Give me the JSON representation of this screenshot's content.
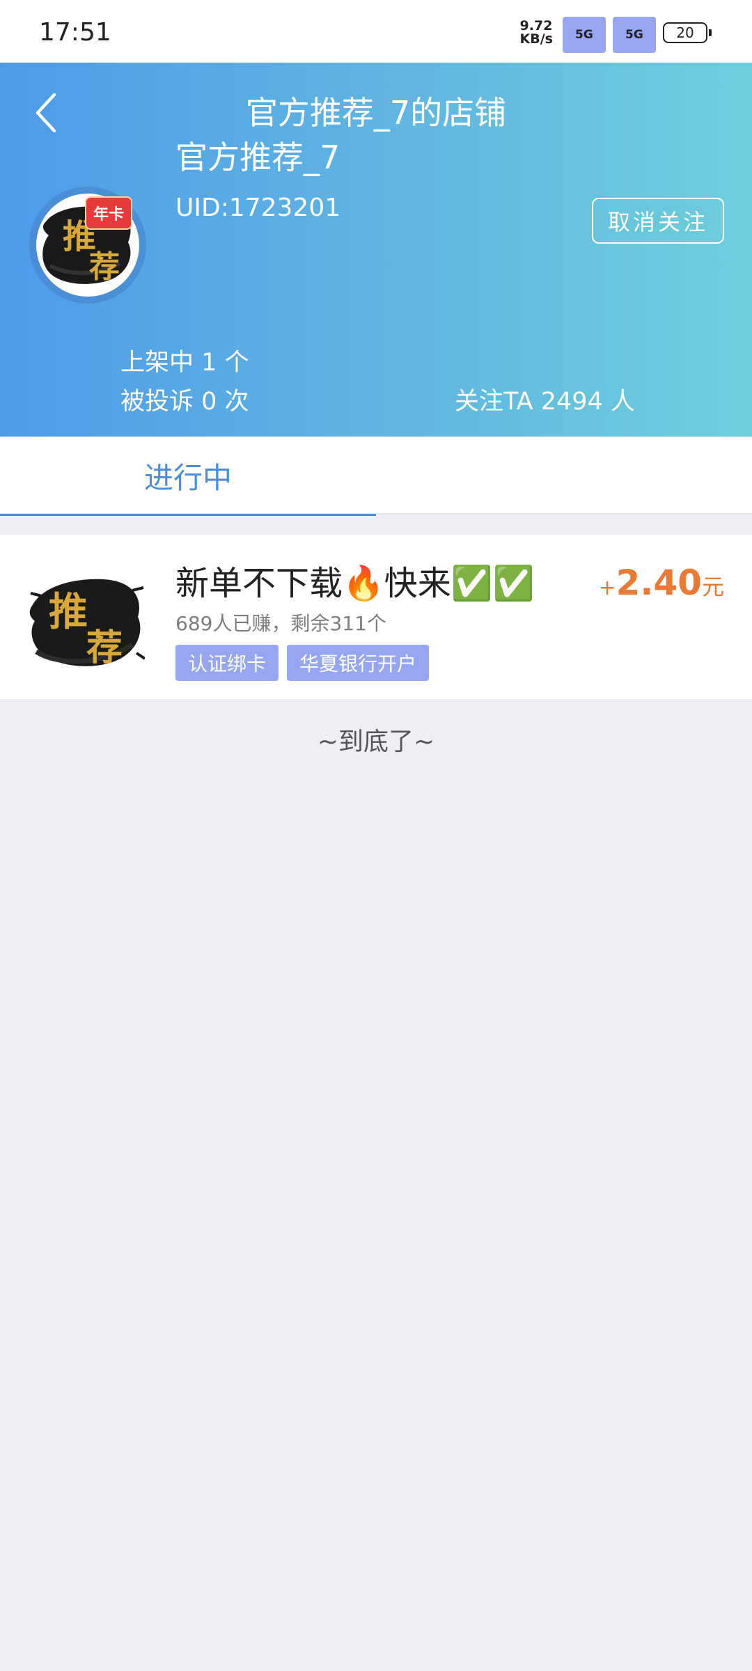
{
  "status_bar": {
    "time": "17:51",
    "net_speed_value": "9.72",
    "net_speed_unit": "KB/s",
    "signal_1": "5G",
    "signal_2": "5G",
    "battery": "20"
  },
  "header": {
    "back_icon": "chevron-left-icon",
    "title": "官方推荐_7的店铺",
    "shop_name": "官方推荐_7",
    "uid": "UID:1723201",
    "unfollow_label": "取消关注",
    "avatar_text_1": "推",
    "avatar_text_2": "荐",
    "avatar_badge": "年卡",
    "stats": {
      "listed": "上架中 1 个",
      "complaints": "被投诉 0 次",
      "followers": "关注TA 2494 人"
    }
  },
  "tabs": [
    {
      "label": "进行中",
      "active": true
    }
  ],
  "tasks": [
    {
      "title": "新单不下载🔥快来✅✅",
      "progress": "689人已赚，剩余311个",
      "tags": [
        "认证绑卡",
        "华夏银行开户"
      ],
      "reward_prefix": "+",
      "reward_amount": "2.40",
      "reward_unit": "元",
      "thumb_text_1": "推",
      "thumb_text_2": "荐"
    }
  ],
  "end_note": "~到底了~",
  "colors": {
    "accent": "#4a8fdc",
    "header_gradient_start": "#4d9be8",
    "header_gradient_end": "#6dcfdb",
    "reward": "#ea7a33",
    "tag_bg": "#96a6f0",
    "background": "#eeeff4"
  }
}
